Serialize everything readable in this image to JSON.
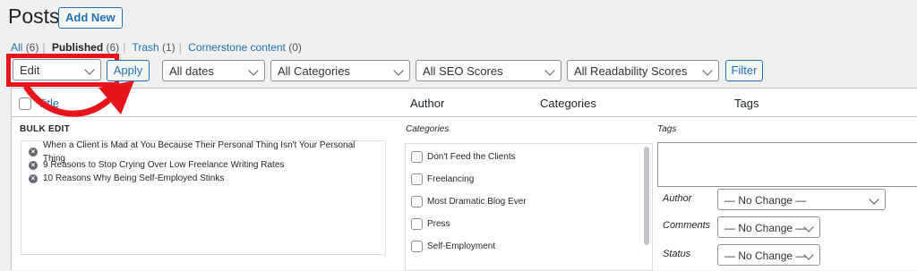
{
  "header": {
    "title": "Posts",
    "add_new": "Add New"
  },
  "views": {
    "all": "All",
    "all_count": "(6)",
    "published": "Published",
    "published_count": "(6)",
    "trash": "Trash",
    "trash_count": "(1)",
    "cornerstone": "Cornerstone content",
    "cornerstone_count": "(0)"
  },
  "filters": {
    "bulk_action": "Edit",
    "apply": "Apply",
    "dates": "All dates",
    "categories": "All Categories",
    "seo": "All SEO Scores",
    "readability": "All Readability Scores",
    "filter": "Filter"
  },
  "table": {
    "col_title": "Title",
    "col_author": "Author",
    "col_categories": "Categories",
    "col_tags": "Tags"
  },
  "bulk_edit": {
    "heading": "BULK EDIT",
    "posts": [
      "When a Client is Mad at You Because Their Personal Thing Isn't Your Personal Thing",
      "9 Reasons to Stop Crying Over Low Freelance Writing Rates",
      "10 Reasons Why Being Self-Employed Stinks"
    ],
    "categories_label": "Categories",
    "categories": [
      "Don't Feed the Clients",
      "Freelancing",
      "Most Dramatic Blog Ever",
      "Press",
      "Self-Employment"
    ],
    "tags_label": "Tags",
    "author_label": "Author",
    "author_value": "— No Change —",
    "comments_label": "Comments",
    "comments_value": "— No Change —",
    "status_label": "Status",
    "status_value": "— No Change —"
  },
  "colors": {
    "accent": "#2271b1",
    "annotation": "#e8141c"
  }
}
